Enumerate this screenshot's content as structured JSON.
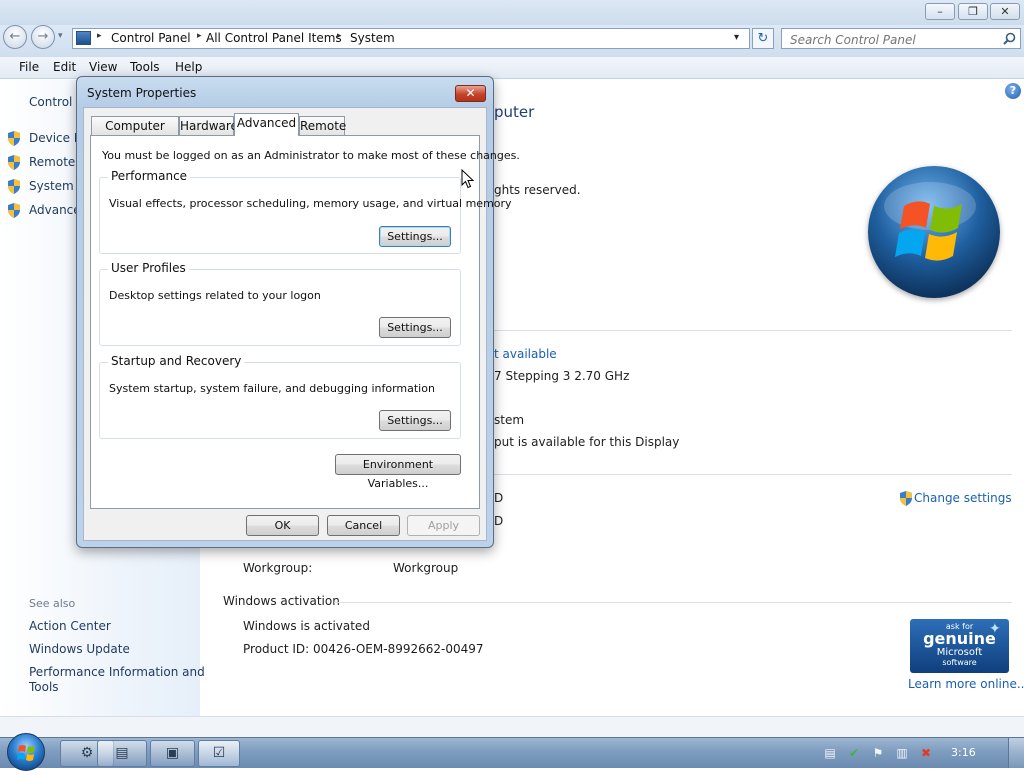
{
  "window": {
    "minimize_glyph": "–",
    "restore_glyph": "❐",
    "close_glyph": "✕"
  },
  "nav": {
    "back_glyph": "←",
    "forward_glyph": "→",
    "dropdown_glyph": "▾",
    "refresh_glyph": "↻"
  },
  "address": {
    "crumbs": [
      "Control Panel",
      "All Control Panel Items",
      "System"
    ],
    "separator": "▸"
  },
  "search": {
    "placeholder": "Search Control Panel",
    "icon": "magnifier-icon"
  },
  "menu": [
    "File",
    "Edit",
    "View",
    "Tools",
    "Help"
  ],
  "left_pane": {
    "home": "Control P",
    "tasks": [
      "Device M",
      "Remote s",
      "System p",
      "Advance"
    ],
    "see_also_label": "See also",
    "see_also": [
      "Action Center",
      "Windows Update",
      "Performance Information and",
      "Tools"
    ]
  },
  "main": {
    "heading_fragment": "puter",
    "copyright_fragment": "ghts reserved.",
    "rating_fragment": "t available",
    "processor_fragment": "7 Stepping 3   2.70 GHz",
    "system_type_fragment": "stem",
    "pen_fragment": "put is available for this Display",
    "row_value_a": "D",
    "row_value_b": "D",
    "change_settings": "Change settings",
    "workgroup_label": "Workgroup:",
    "workgroup_value": "Workgroup",
    "activation_heading": "Windows activation",
    "activation_status": "Windows is activated",
    "product_id": "Product ID: 00426-OEM-8992662-00497",
    "genuine_line1": "ask for",
    "genuine_line2": "genuine",
    "genuine_line3": "Microsoft",
    "genuine_line4": "software",
    "learn_more": "Learn more online..."
  },
  "dialog": {
    "title": "System Properties",
    "close_glyph": "✕",
    "tabs": [
      "Computer Name",
      "Hardware",
      "Advanced",
      "Remote"
    ],
    "active_tab": "Advanced",
    "admin_note": "You must be logged on as an Administrator to make most of these changes.",
    "groups": [
      {
        "label": "Performance",
        "desc": "Visual effects, processor scheduling, memory usage, and virtual memory",
        "button": "Settings..."
      },
      {
        "label": "User Profiles",
        "desc": "Desktop settings related to your logon",
        "button": "Settings..."
      },
      {
        "label": "Startup and Recovery",
        "desc": "System startup, system failure, and debugging information",
        "button": "Settings..."
      }
    ],
    "env_button": "Environment Variables...",
    "ok": "OK",
    "cancel": "Cancel",
    "apply": "Apply"
  },
  "taskbar": {
    "buttons": [
      "⚙",
      "▤",
      "▣",
      "☑"
    ],
    "tray": [
      "▤",
      "✔",
      "⚑",
      "▥",
      "✖"
    ],
    "clock": "3:16"
  },
  "colors": {
    "link": "#1a5fb4",
    "window_blue": "#cddcec",
    "close_red": "#c6432b"
  }
}
